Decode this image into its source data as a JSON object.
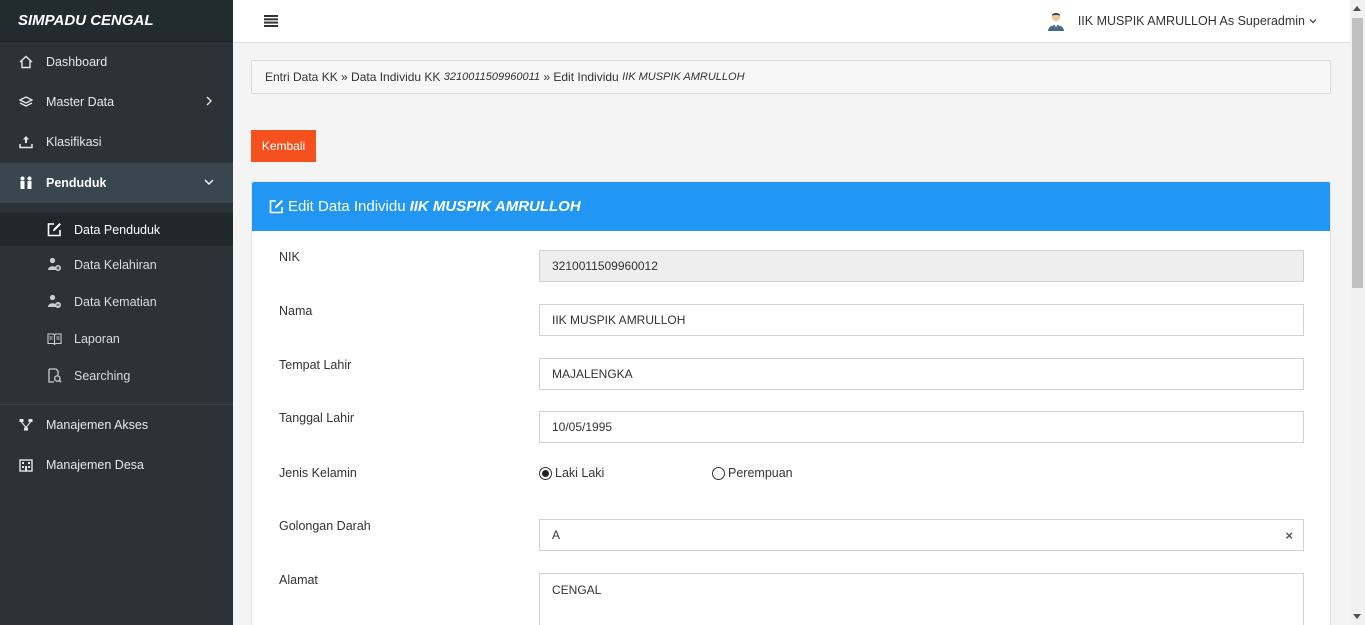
{
  "brand": "SIMPADU CENGAL",
  "sidebar": {
    "items_top": [
      {
        "label": "Dashboard",
        "icon": "home-icon"
      },
      {
        "label": "Master Data",
        "icon": "layers-icon"
      },
      {
        "label": "Klasifikasi",
        "icon": "upload-tray-icon"
      }
    ],
    "active": {
      "label": "Penduduk",
      "icon": "people-icon"
    },
    "sub_items": [
      {
        "label": "Data Penduduk",
        "icon": "edit-icon"
      },
      {
        "label": "Data Kelahiran",
        "icon": "user-add-icon"
      },
      {
        "label": "Data Kematian",
        "icon": "user-remove-icon"
      },
      {
        "label": "Laporan",
        "icon": "book-icon"
      },
      {
        "label": "Searching",
        "icon": "file-search-icon"
      }
    ],
    "items_bottom": [
      {
        "label": "Manajemen Akses",
        "icon": "network-icon"
      },
      {
        "label": "Manajemen Desa",
        "icon": "building-icon"
      }
    ]
  },
  "topbar": {
    "user_label": "IIK MUSPIK AMRULLOH As Superadmin"
  },
  "breadcrumb": {
    "part1": "Entri Data KK » Data Individu KK ",
    "kk_number": "3210011509960011",
    "part2": " » Edit Individu ",
    "name": "IIK MUSPIK AMRULLOH"
  },
  "back_button": "Kembali",
  "panel": {
    "title": "Edit Data Individu",
    "title_name": "IIK MUSPIK AMRULLOH"
  },
  "form": {
    "nik": {
      "label": "NIK",
      "value": "3210011509960012"
    },
    "nama": {
      "label": "Nama",
      "value": "IIK MUSPIK AMRULLOH"
    },
    "tempat_lahir": {
      "label": "Tempat Lahir",
      "value": "MAJALENGKA"
    },
    "tanggal_lahir": {
      "label": "Tanggal Lahir",
      "value": "10/05/1995"
    },
    "jenis_kelamin": {
      "label": "Jenis Kelamin",
      "options": [
        "Laki Laki",
        "Perempuan"
      ],
      "selected": "Laki Laki"
    },
    "golongan_darah": {
      "label": "Golongan Darah",
      "value": "A",
      "clear": "×"
    },
    "alamat": {
      "label": "Alamat",
      "value": "CENGAL"
    }
  }
}
